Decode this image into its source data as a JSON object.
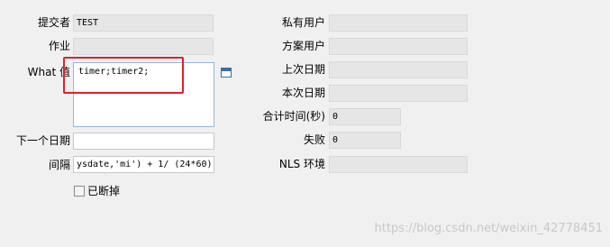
{
  "form": {
    "submitter": {
      "label": "提交者",
      "value": "TEST"
    },
    "job": {
      "label": "作业",
      "value": ""
    },
    "what": {
      "label": "What 值",
      "value": "timer;timer2;"
    },
    "next_date": {
      "label": "下一个日期",
      "value": ""
    },
    "interval": {
      "label": "间隔",
      "value": "ysdate,'mi') + 1/ (24*60)"
    },
    "broken": {
      "label": "已断掉",
      "checked": false
    },
    "private_user": {
      "label": "私有用户",
      "value": ""
    },
    "schema_user": {
      "label": "方案用户",
      "value": ""
    },
    "last_date": {
      "label": "上次日期",
      "value": ""
    },
    "this_date": {
      "label": "本次日期",
      "value": ""
    },
    "total_time": {
      "label": "合计时间(秒)",
      "value": "0"
    },
    "failures": {
      "label": "失败",
      "value": "0"
    },
    "nls_env": {
      "label": "NLS 环境",
      "value": ""
    }
  },
  "watermark": "https://blog.csdn.net/weixin_42778451",
  "colors": {
    "background": "#f0f0f0",
    "readonly_field": "#e6e6e6",
    "highlight": "#e0202a",
    "icon": "#3a6ea5"
  }
}
